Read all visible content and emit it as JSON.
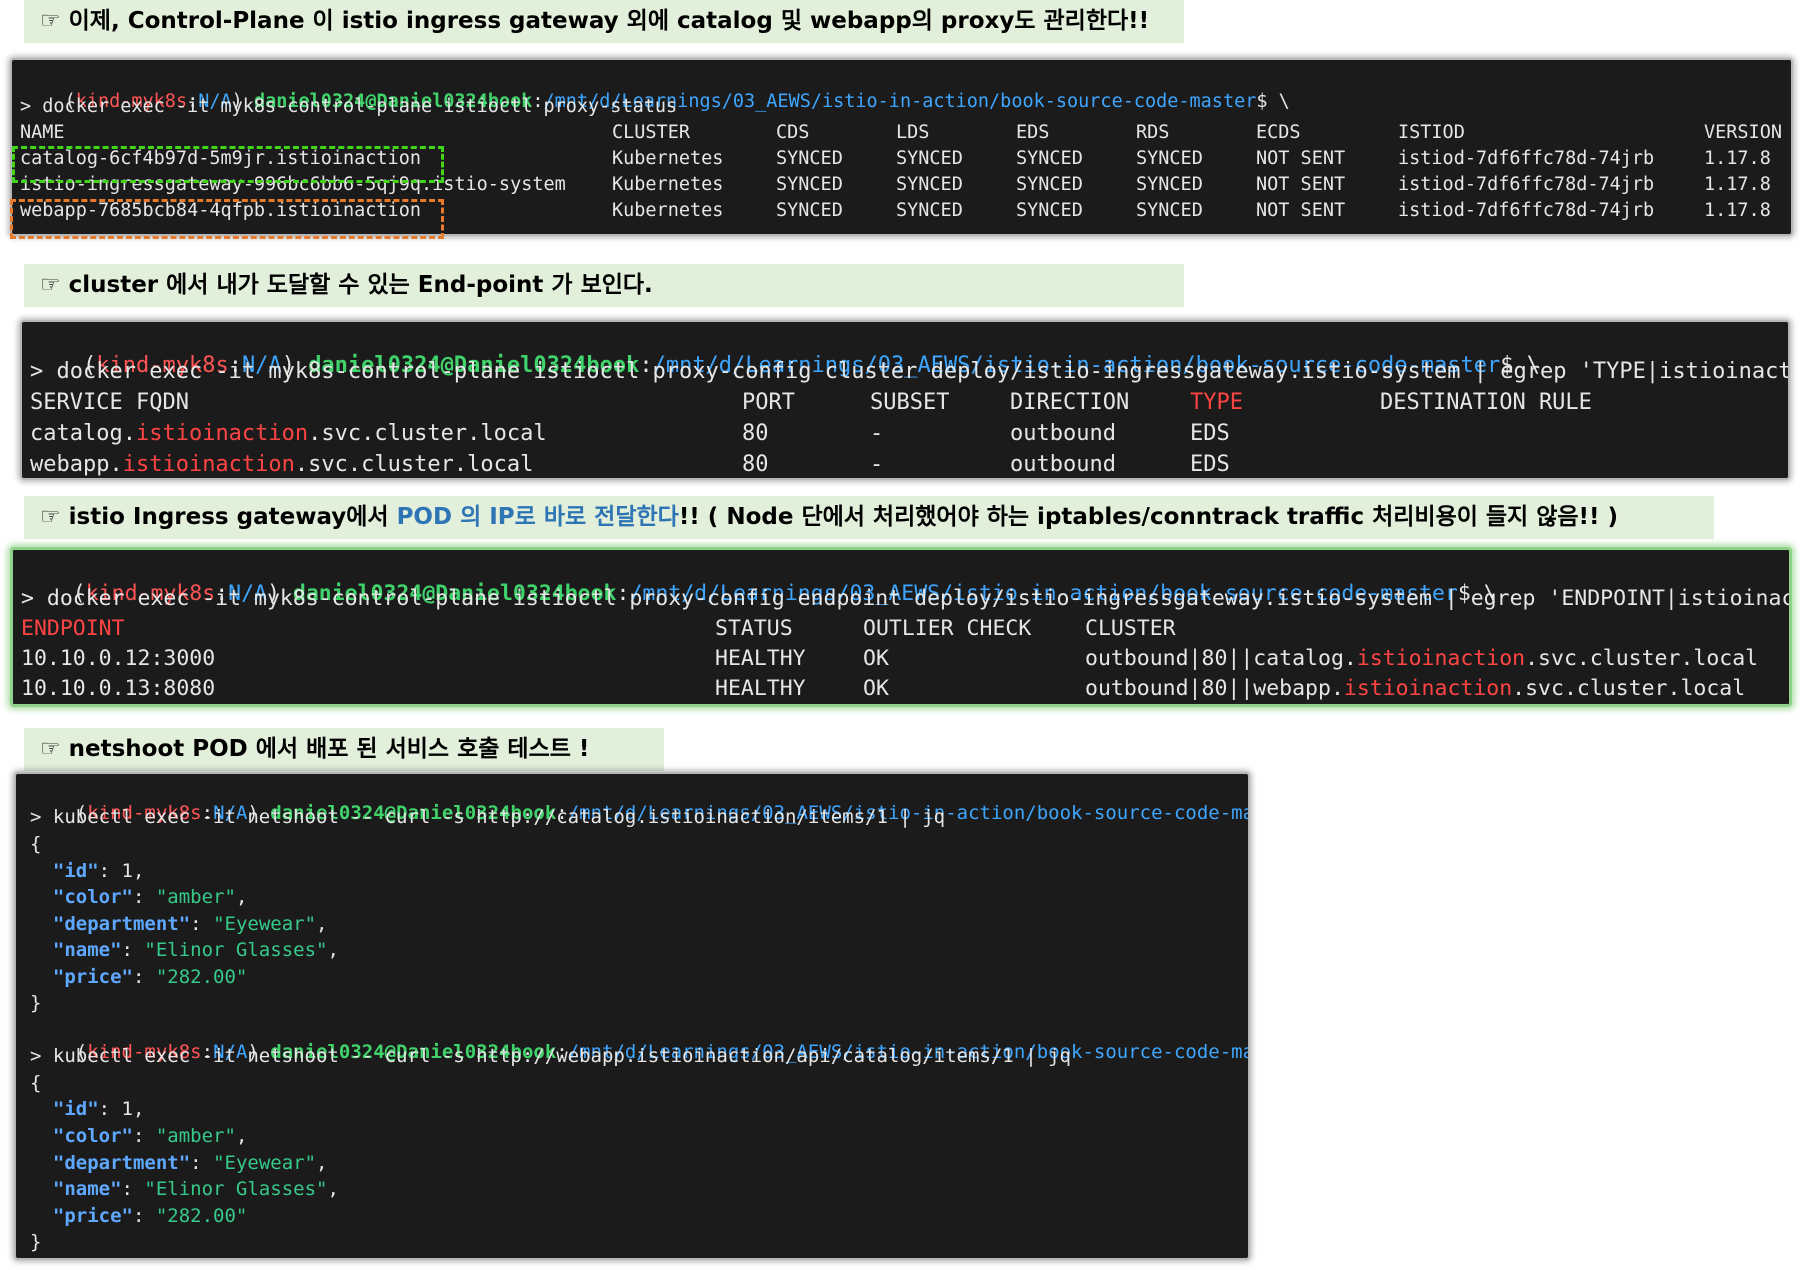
{
  "banners": {
    "b1": "☞ 이제, Control-Plane 이 istio ingress gateway 외에 catalog 및 webapp의 proxy도 관리한다!!",
    "b2": "☞ cluster 에서 내가 도달할 수 있는 End-point 가 보인다.",
    "b3_pre": "☞ istio Ingress gateway에서 ",
    "b3_blue": "POD 의 IP로 바로 전달한다",
    "b3_post": "!!  ( Node 단에서 처리했어야 하는 iptables/conntrack traffic 처리비용이 들지 않음!! )",
    "b4": "☞ netshoot POD 에서 배포 된 서비스 호출 테스트 !"
  },
  "prompt": {
    "open": "(",
    "context": "kind-myk8s",
    "sep": ":",
    "ns": "N/A",
    "close": ") ",
    "user": "daniel0324@Daniel0324book",
    "colon": ":",
    "path": "/mnt/d/Learnings/03_AEWS/istio-in-action/book-source-code-master",
    "tail": "$ \\"
  },
  "t1": {
    "command": "> docker exec -it myk8s-control-plane istioctl proxy-status",
    "headers": [
      "NAME",
      "CLUSTER",
      "CDS",
      "LDS",
      "EDS",
      "RDS",
      "ECDS",
      "ISTIOD",
      "VERSION"
    ],
    "rows": [
      [
        "catalog-6cf4b97d-5m9jr.istioinaction",
        "Kubernetes",
        "SYNCED",
        "SYNCED",
        "SYNCED",
        "SYNCED",
        "NOT SENT",
        "istiod-7df6ffc78d-74jrb",
        "1.17.8"
      ],
      [
        "istio-ingressgateway-996bc6bb6-5qj9q.istio-system",
        "Kubernetes",
        "SYNCED",
        "SYNCED",
        "SYNCED",
        "SYNCED",
        "NOT SENT",
        "istiod-7df6ffc78d-74jrb",
        "1.17.8"
      ],
      [
        "webapp-7685bcb84-4qfpb.istioinaction",
        "Kubernetes",
        "SYNCED",
        "SYNCED",
        "SYNCED",
        "SYNCED",
        "NOT SENT",
        "istiod-7df6ffc78d-74jrb",
        "1.17.8"
      ]
    ]
  },
  "t2": {
    "command": "> docker exec -it myk8s-control-plane istioctl proxy-config cluster deploy/istio-ingressgateway.istio-system | egrep 'TYPE|istioinaction'",
    "headers": [
      "SERVICE FQDN",
      "PORT",
      "SUBSET",
      "DIRECTION",
      "TYPE",
      "DESTINATION RULE"
    ],
    "rows": [
      {
        "pre": "catalog.",
        "hl": "istioinaction",
        "post": ".svc.cluster.local",
        "port": "80",
        "subset": "-",
        "direction": "outbound",
        "type": "EDS"
      },
      {
        "pre": "webapp.",
        "hl": "istioinaction",
        "post": ".svc.cluster.local",
        "port": "80",
        "subset": "-",
        "direction": "outbound",
        "type": "EDS"
      }
    ]
  },
  "t3": {
    "command": "> docker exec -it myk8s-control-plane istioctl proxy-config endpoint deploy/istio-ingressgateway.istio-system | egrep 'ENDPOINT|istioinaction'",
    "headers": [
      "ENDPOINT",
      "STATUS",
      "OUTLIER CHECK",
      "CLUSTER"
    ],
    "rows": [
      {
        "endpoint": "10.10.0.12:3000",
        "status": "HEALTHY",
        "outlier": "OK",
        "pre": "outbound|80||catalog.",
        "hl": "istioinaction",
        "post": ".svc.cluster.local"
      },
      {
        "endpoint": "10.10.0.13:8080",
        "status": "HEALTHY",
        "outlier": "OK",
        "pre": "outbound|80||webapp.",
        "hl": "istioinaction",
        "post": ".svc.cluster.local"
      }
    ]
  },
  "t4": {
    "command1": "> kubectl exec -it netshoot -- curl -s http://catalog.istioinaction/items/1 | jq",
    "command2": "> kubectl exec -it netshoot -- curl -s http://webapp.istioinaction/api/catalog/items/1 | jq",
    "open_brace": "{",
    "close_brace": "}",
    "json": [
      {
        "key": "\"id\"",
        "colon": ": ",
        "num": "1",
        "str": "",
        "comma": ","
      },
      {
        "key": "\"color\"",
        "colon": ": ",
        "num": "",
        "str": "\"amber\"",
        "comma": ","
      },
      {
        "key": "\"department\"",
        "colon": ": ",
        "num": "",
        "str": "\"Eyewear\"",
        "comma": ","
      },
      {
        "key": "\"name\"",
        "colon": ": ",
        "num": "",
        "str": "\"Elinor Glasses\"",
        "comma": ","
      },
      {
        "key": "\"price\"",
        "colon": ": ",
        "num": "",
        "str": "\"282.00\"",
        "comma": ""
      }
    ]
  }
}
